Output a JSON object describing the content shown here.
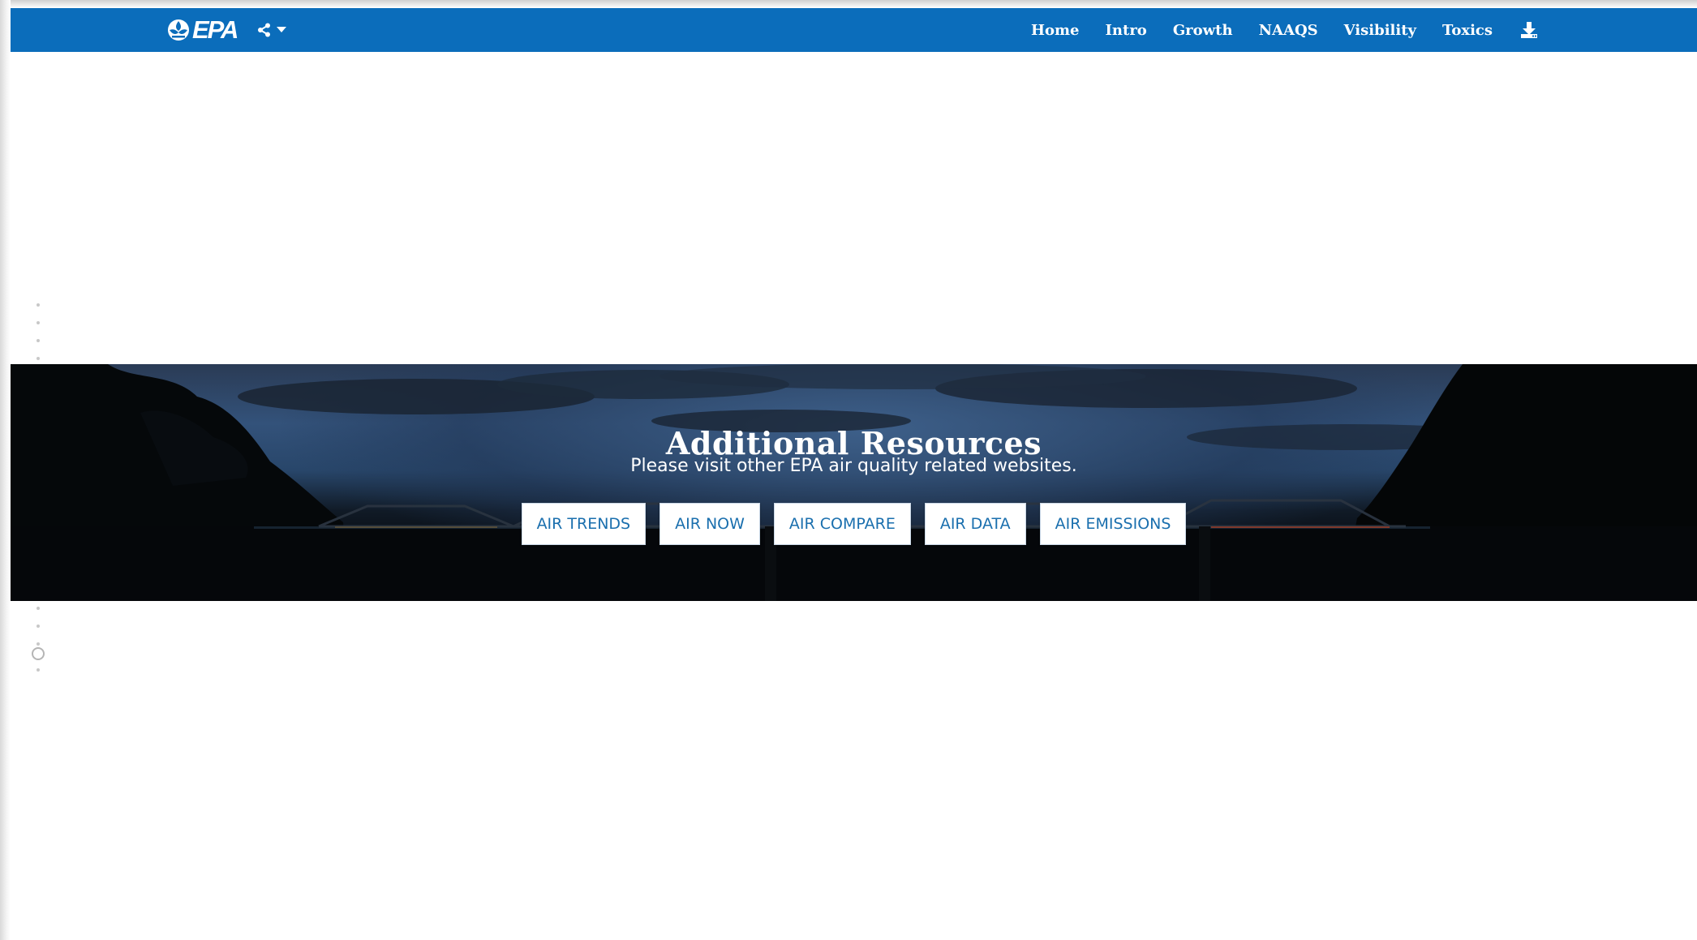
{
  "header": {
    "logo_text": "EPA",
    "logo_icon": "epa-flower-icon",
    "share_icon": "share-icon",
    "share_caret_icon": "caret-down-icon",
    "nav": [
      {
        "label": "Home"
      },
      {
        "label": "Intro"
      },
      {
        "label": "Growth"
      },
      {
        "label": "NAAQS"
      },
      {
        "label": "Visibility"
      },
      {
        "label": "Toxics"
      }
    ],
    "download_icon": "download-icon",
    "bar_color": "#0b6dbb"
  },
  "banner": {
    "title": "Additional Resources",
    "subtitle": "Please visit other EPA air quality related websites.",
    "buttons": [
      {
        "label": "AIR TRENDS"
      },
      {
        "label": "AIR NOW"
      },
      {
        "label": "AIR COMPARE"
      },
      {
        "label": "AIR DATA"
      },
      {
        "label": "AIR EMISSIONS"
      }
    ],
    "button_text_color": "#1a6fae"
  },
  "scroll_indicator": {
    "current_section": "circle-marker-icon"
  }
}
